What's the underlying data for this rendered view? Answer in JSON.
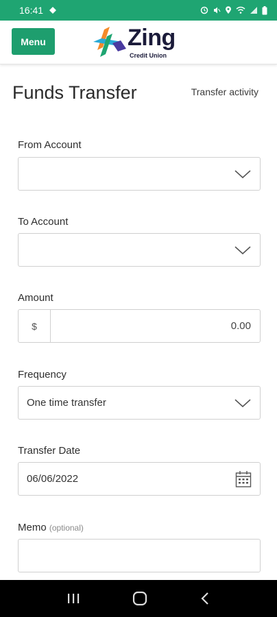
{
  "status_bar": {
    "time": "16:41",
    "bg_color": "#1fa572"
  },
  "header": {
    "menu_label": "Menu",
    "logo_text": "Zing",
    "logo_subtitle": "Credit Union"
  },
  "page": {
    "title": "Funds Transfer",
    "activity_link": "Transfer activity"
  },
  "form": {
    "from_account": {
      "label": "From Account",
      "value": ""
    },
    "to_account": {
      "label": "To Account",
      "value": ""
    },
    "amount": {
      "label": "Amount",
      "prefix": "$",
      "placeholder": "0.00"
    },
    "frequency": {
      "label": "Frequency",
      "value": "One time transfer"
    },
    "transfer_date": {
      "label": "Transfer Date",
      "value": "06/06/2022"
    },
    "memo": {
      "label": "Memo",
      "optional": "(optional)",
      "value": ""
    }
  },
  "icons": {
    "dropdown": "chevron-down-icon",
    "calendar": "calendar-icon",
    "nav_recent": "recent-apps-icon",
    "nav_home": "home-icon",
    "nav_back": "back-icon"
  },
  "colors": {
    "accent": "#1e9e6e",
    "border": "#cfcfcf",
    "nav_bg": "#000000"
  }
}
